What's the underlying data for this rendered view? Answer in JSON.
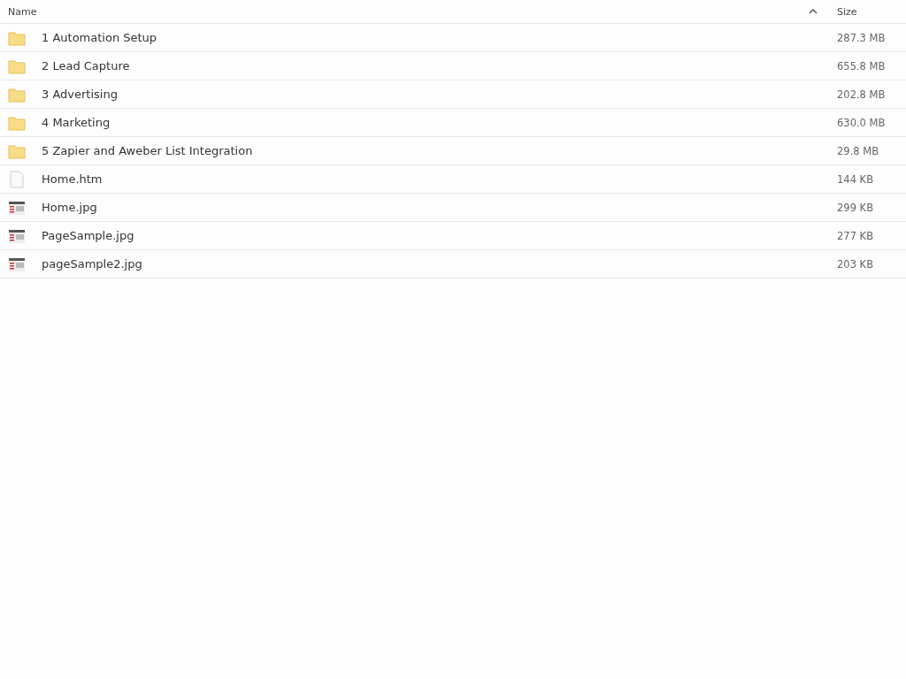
{
  "columns": [
    {
      "label": "Name"
    },
    {
      "label": "Size"
    }
  ],
  "rows": [
    {
      "kind": "folder",
      "name": "1 Automation Setup",
      "size": "287.3 MB"
    },
    {
      "kind": "folder",
      "name": "2 Lead Capture",
      "size": "655.8 MB"
    },
    {
      "kind": "folder",
      "name": "3 Advertising",
      "size": "202.8 MB"
    },
    {
      "kind": "folder",
      "name": "4 Marketing",
      "size": "630.0 MB"
    },
    {
      "kind": "folder",
      "name": "5 Zapier and Aweber List Integration",
      "size": "29.8 MB"
    },
    {
      "kind": "file",
      "name": "Home.htm",
      "size": "144 KB"
    },
    {
      "kind": "image",
      "name": "Home.jpg",
      "size": "299 KB"
    },
    {
      "kind": "image",
      "name": "PageSample.jpg",
      "size": "277 KB"
    },
    {
      "kind": "image",
      "name": "pageSample2.jpg",
      "size": "203 KB"
    }
  ]
}
